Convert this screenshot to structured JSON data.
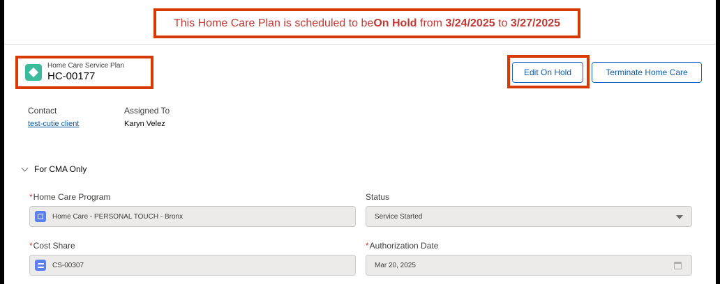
{
  "banner": {
    "prefix": "This Home Care Plan is scheduled to be ",
    "status": "On Hold",
    "from_word": " from ",
    "start_date": "3/24/2025",
    "to_word": " to ",
    "end_date": "3/27/2025"
  },
  "record": {
    "type_label": "Home Care Service Plan",
    "name": "HC-00177",
    "icon": "diamond-icon"
  },
  "actions": {
    "edit_on_hold": "Edit On Hold",
    "terminate": "Terminate Home Care"
  },
  "highlights": {
    "contact_label": "Contact",
    "contact_value": "test-cutie client",
    "assigned_label": "Assigned To",
    "assigned_value": "Karyn Velez"
  },
  "section": {
    "title": "For CMA Only"
  },
  "fields": {
    "program_label": "Home Care Program",
    "program_value": "Home Care - PERSONAL TOUCH - Bronx",
    "status_label": "Status",
    "status_value": "Service Started",
    "cost_share_label": "Cost Share",
    "cost_share_value": "CS-00307",
    "auth_date_label": "Authorization Date",
    "auth_date_value": "Mar 20, 2025"
  },
  "colors": {
    "highlight_border": "#d83b01",
    "banner_text": "#c23934",
    "brand_blue": "#0b5cab",
    "record_icon": "#3bba9c"
  }
}
